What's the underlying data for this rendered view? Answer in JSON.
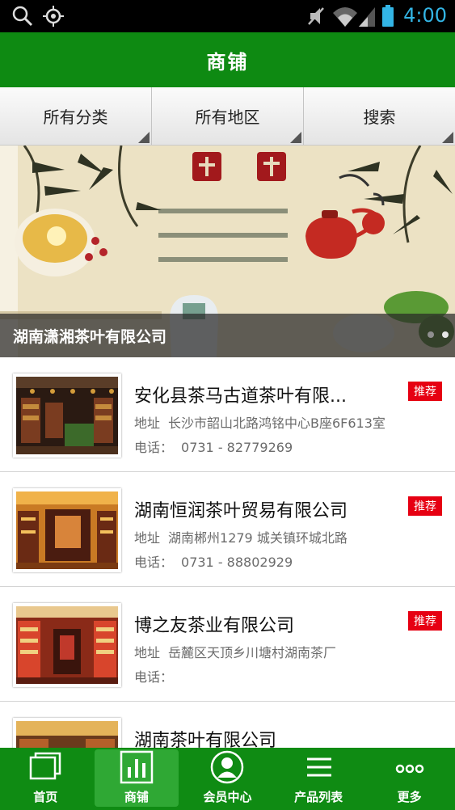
{
  "status_bar": {
    "time": "4:00",
    "icons": [
      "search-icon",
      "gps-icon",
      "mute-icon",
      "wifi-icon",
      "signal-icon",
      "battery-icon"
    ]
  },
  "header": {
    "title": "商铺"
  },
  "filters": [
    {
      "label": "所有分类"
    },
    {
      "label": "所有地区"
    },
    {
      "label": "搜索"
    }
  ],
  "banner": {
    "caption": "湖南潇湘茶叶有限公司",
    "slide_count": 2,
    "active_slide": 2
  },
  "shops": [
    {
      "name": "安化县茶马古道茶叶有限...",
      "badge": "推荐",
      "addr_label": "地址",
      "addr": "长沙市韶山北路鸿铭中心B座6F613室",
      "phone_label": "电话：",
      "phone": "0731 - 82779269"
    },
    {
      "name": "湖南恒润茶叶贸易有限公司",
      "badge": "推荐",
      "addr_label": "地址",
      "addr": "湖南郴州1279 城关镇环城北路",
      "phone_label": "电话：",
      "phone": "0731 - 88802929"
    },
    {
      "name": "博之友茶业有限公司",
      "badge": "推荐",
      "addr_label": "地址",
      "addr": "岳麓区天顶乡川塘村湖南茶厂",
      "phone_label": "电话：",
      "phone": ""
    },
    {
      "name": "湖南茶叶有限公司",
      "badge": "",
      "addr_label": "",
      "addr": "",
      "phone_label": "",
      "phone": ""
    }
  ],
  "bottom_nav": [
    {
      "label": "首页",
      "icon": "home-icon",
      "active": false
    },
    {
      "label": "商铺",
      "icon": "shop-icon",
      "active": true
    },
    {
      "label": "会员中心",
      "icon": "member-icon",
      "active": false
    },
    {
      "label": "产品列表",
      "icon": "product-list-icon",
      "active": false
    },
    {
      "label": "更多",
      "icon": "more-icon",
      "active": false
    }
  ],
  "colors": {
    "brand_green": "#0e8a12",
    "badge_red": "#e60012",
    "time_blue": "#33b5e5"
  }
}
